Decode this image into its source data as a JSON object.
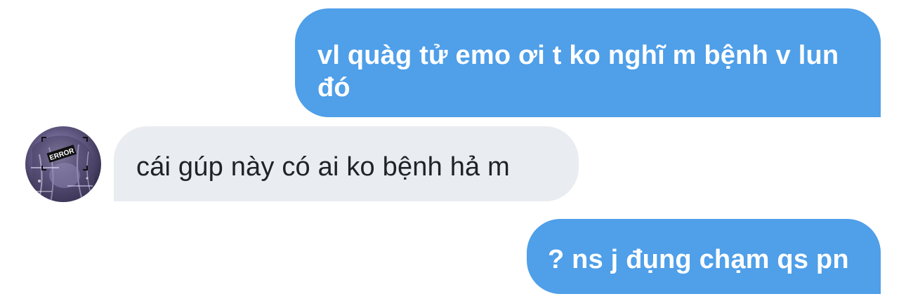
{
  "conversation": {
    "messages": [
      {
        "direction": "outgoing",
        "text": "vl quàg tử emo ơi t ko nghĩ m bệnh v lun đó"
      },
      {
        "direction": "incoming",
        "text": "cái gúp này có ai ko bệnh hả m"
      },
      {
        "direction": "outgoing",
        "text": "? ns j đụng chạm qs pn"
      }
    ],
    "avatar": {
      "badge_text": "ERROR",
      "icon": "error-glitch-avatar"
    }
  },
  "colors": {
    "outgoing_bubble": "#4f9fe9",
    "incoming_bubble": "#e9ecf0",
    "outgoing_text": "#ffffff",
    "incoming_text": "#1f2329",
    "background": "#ffffff"
  }
}
